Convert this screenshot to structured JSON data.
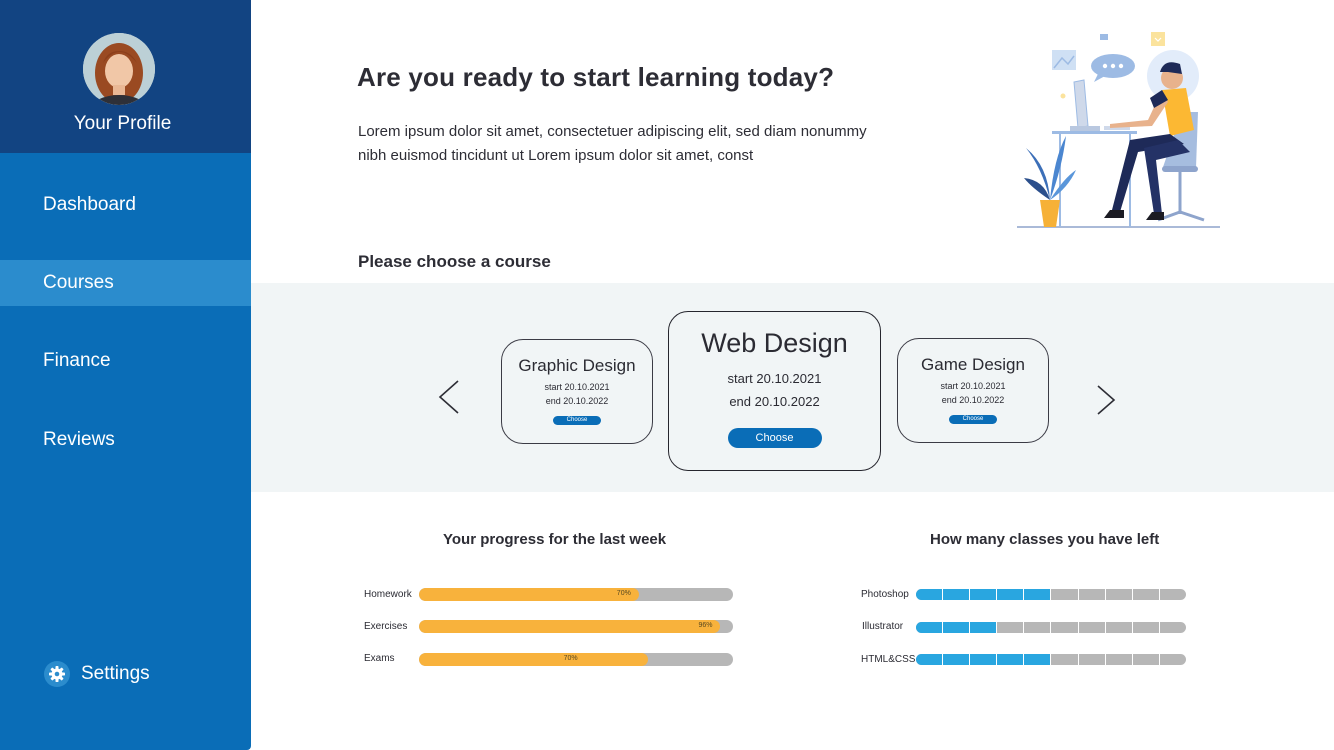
{
  "sidebar": {
    "profile_label": "Your Profile",
    "items": [
      {
        "label": "Dashboard",
        "active": false
      },
      {
        "label": "Courses",
        "active": true
      },
      {
        "label": "Finance",
        "active": false
      },
      {
        "label": "Reviews",
        "active": false
      }
    ],
    "settings_label": "Settings"
  },
  "header": {
    "title": "Are you ready to start learning today?",
    "intro": "Lorem ipsum dolor sit amet, consectetuer adipiscing elit, sed diam nonummy nibh euismod tincidunt ut Lorem ipsum dolor sit amet, const"
  },
  "courses": {
    "section_title": "Please choose a course",
    "cards": [
      {
        "title": "Graphic Design",
        "start": "start 20.10.2021",
        "end": "end 20.10.2022",
        "button": "Choose"
      },
      {
        "title": "Web Design",
        "start": "start 20.10.2021",
        "end": "end 20.10.2022",
        "button": "Choose"
      },
      {
        "title": "Game Design",
        "start": "start 20.10.2021",
        "end": "end 20.10.2022",
        "button": "Choose"
      }
    ]
  },
  "progress": {
    "title": "Your progress for the last week",
    "rows": [
      {
        "label": "Homework",
        "value": 70,
        "pct_label": "70%"
      },
      {
        "label": "Exercises",
        "value": 96,
        "pct_label": "96%"
      },
      {
        "label": "Exams",
        "value": 73,
        "pct_label": "70%"
      }
    ]
  },
  "classes_left": {
    "title": "How many classes you have left",
    "total_segments": 10,
    "rows": [
      {
        "label": "Photoshop",
        "filled": 5
      },
      {
        "label": "Illustrator",
        "filled": 3
      },
      {
        "label": "HTML&CSS",
        "filled": 5
      }
    ]
  },
  "colors": {
    "sidebar": "#0a6db7",
    "profile_header": "#124482",
    "progress_fill": "#f8b23c",
    "segment_fill": "#29a6e0",
    "track": "#b7b7b7"
  }
}
